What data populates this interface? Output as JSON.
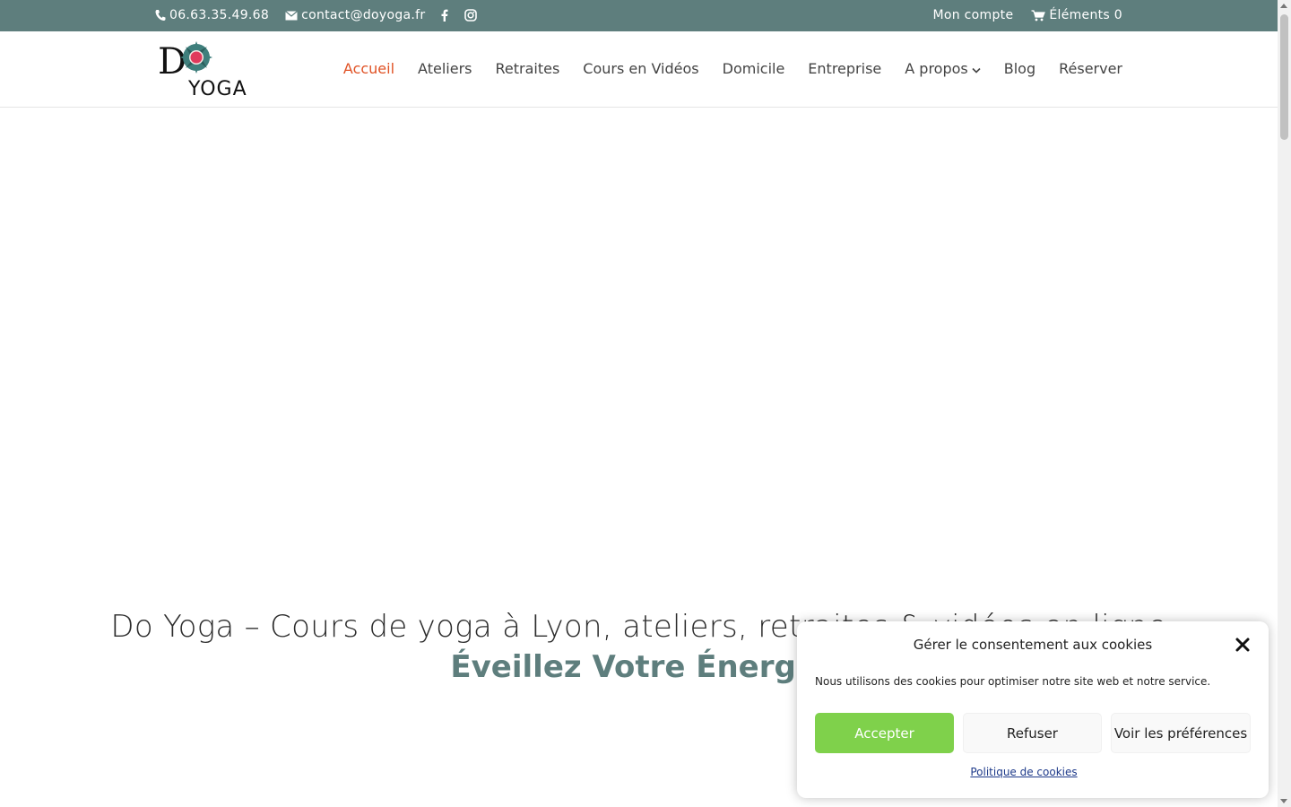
{
  "topbar": {
    "phone": "06.63.35.49.68",
    "email": "contact@doyoga.fr",
    "account": "Mon compte",
    "cart": "Éléments 0",
    "colors": {
      "bar": "#5e7e7d"
    }
  },
  "header": {
    "logo_text_top": "D",
    "logo_text_bottom": "YOGA",
    "nav": [
      {
        "label": "Accueil",
        "active": true
      },
      {
        "label": "Ateliers"
      },
      {
        "label": "Retraites"
      },
      {
        "label": "Cours en Vidéos"
      },
      {
        "label": "Domicile"
      },
      {
        "label": "Entreprise"
      },
      {
        "label": "A propos",
        "has_dropdown": true
      },
      {
        "label": "Blog"
      },
      {
        "label": "Réserver"
      }
    ],
    "colors": {
      "active": "#e05225"
    }
  },
  "hero": {
    "title": "Do Yoga – Cours de yoga à Lyon, ateliers, retraites & vidéos en ligne",
    "subtitle": "Éveillez Votre Énergie"
  },
  "cookie": {
    "title": "Gérer le consentement aux cookies",
    "text": "Nous utilisons des cookies pour optimiser notre site web et notre service.",
    "accept": "Accepter",
    "refuse": "Refuser",
    "prefs": "Voir les préférences",
    "policy": "Politique de cookies",
    "colors": {
      "accept": "#7fd14b"
    }
  }
}
